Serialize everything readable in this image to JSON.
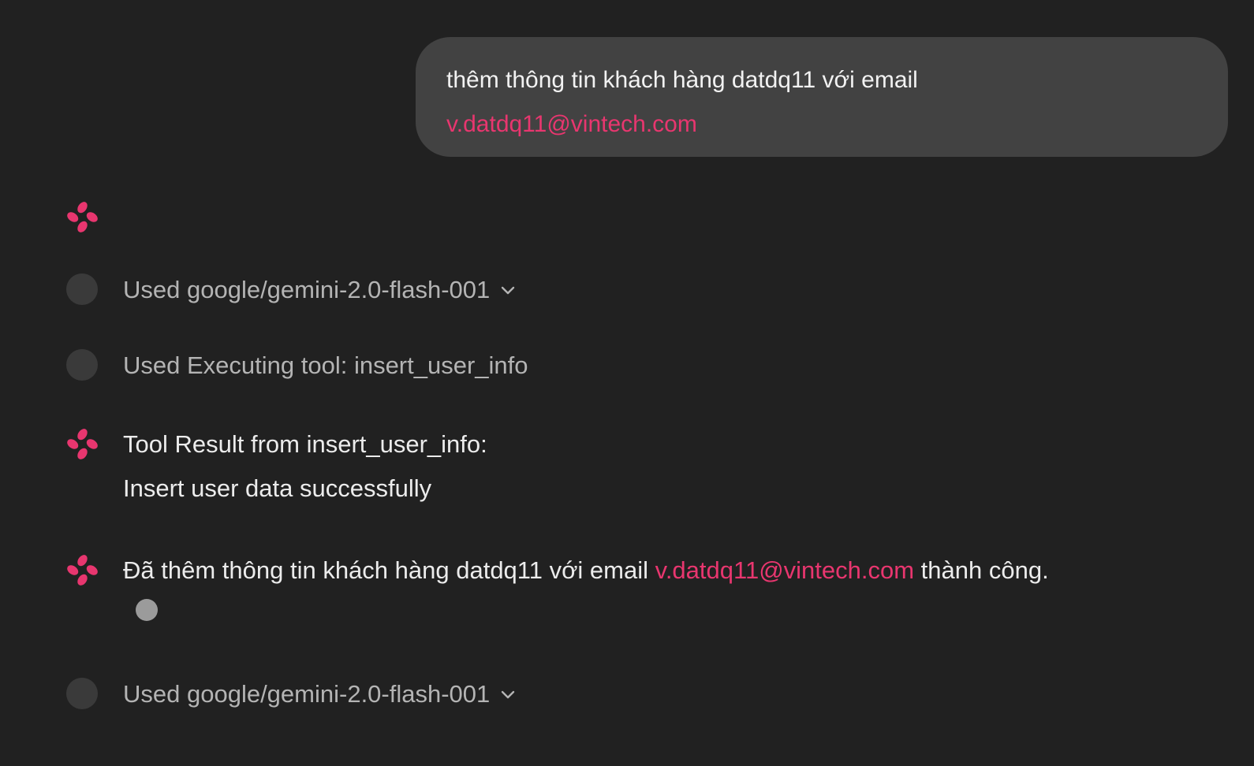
{
  "user_message": {
    "line1": "thêm thông tin khách hàng datdq11 với email",
    "email_link": "v.datdq11@vintech.com"
  },
  "steps": {
    "model_used_1": "Used google/gemini-2.0-flash-001",
    "tool_exec": "Used Executing tool: insert_user_info",
    "tool_result_title": "Tool Result from insert_user_info:",
    "tool_result_body": "Insert user data successfully",
    "final_answer_prefix": "Đã thêm thông tin khách hàng datdq11 với email ",
    "final_answer_email": "v.datdq11@vintech.com",
    "final_answer_suffix": " thành công.",
    "model_used_2": "Used google/gemini-2.0-flash-001"
  },
  "icons": {
    "assistant": "assistant-logo-icon",
    "step": "step-circle-icon",
    "chevron": "chevron-down-icon",
    "typing": "typing-dot-icon"
  },
  "colors": {
    "background": "#212121",
    "bubble": "#424242",
    "accent": "#e8366f",
    "muted_text": "#b4b4b4"
  }
}
